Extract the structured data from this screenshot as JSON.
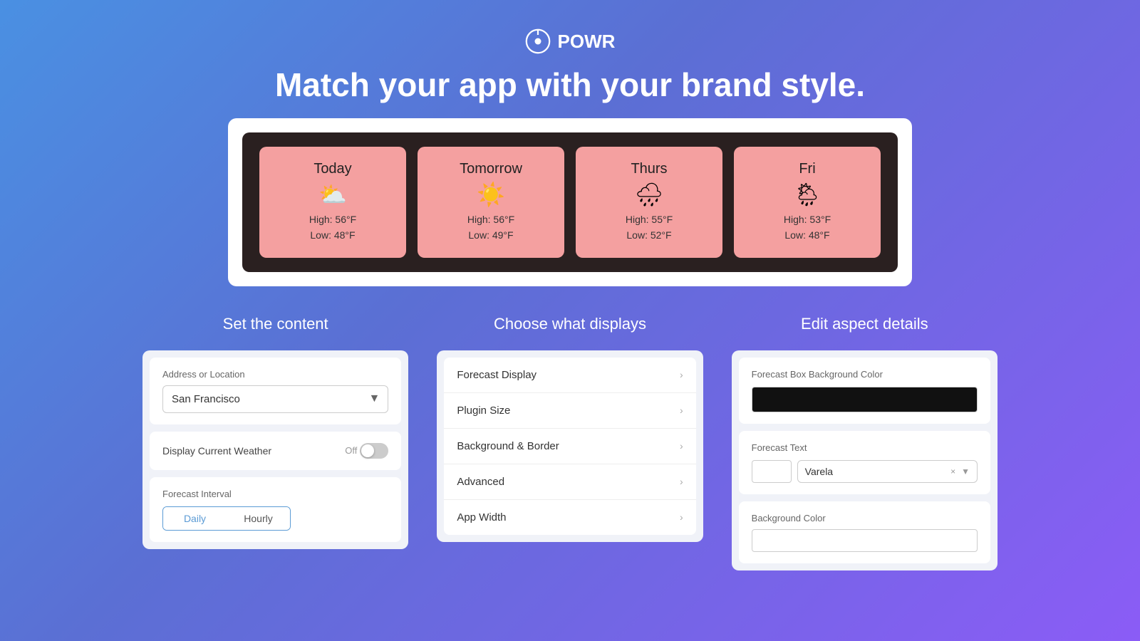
{
  "brand": {
    "name": "POWR"
  },
  "hero": {
    "title": "Match your app with your brand style."
  },
  "forecast": {
    "cards": [
      {
        "day": "Today",
        "icon": "⛅",
        "high": "High: 56°F",
        "low": "Low: 48°F"
      },
      {
        "day": "Tomorrow",
        "icon": "☀️",
        "high": "High: 56°F",
        "low": "Low: 49°F"
      },
      {
        "day": "Thurs",
        "icon": "🌧",
        "high": "High: 55°F",
        "low": "Low: 52°F"
      },
      {
        "day": "Fri",
        "icon": "🌦",
        "high": "High: 53°F",
        "low": "Low: 48°F"
      }
    ]
  },
  "content_section": {
    "title": "Set the content",
    "address_label": "Address or Location",
    "address_value": "San Francisco",
    "display_current_label": "Display Current Weather",
    "toggle_state": "Off",
    "interval_label": "Forecast Interval",
    "daily_btn": "Daily",
    "hourly_btn": "Hourly"
  },
  "display_section": {
    "title": "Choose what displays",
    "items": [
      {
        "label": "Forecast Display"
      },
      {
        "label": "Plugin Size"
      },
      {
        "label": "Background & Border"
      },
      {
        "label": "Advanced"
      },
      {
        "label": "App Width"
      }
    ]
  },
  "edit_section": {
    "title": "Edit aspect details",
    "box_bg_color_label": "Forecast Box Background Color",
    "forecast_text_label": "Forecast Text",
    "font_name": "Varela",
    "bg_color_label": "Background Color"
  }
}
